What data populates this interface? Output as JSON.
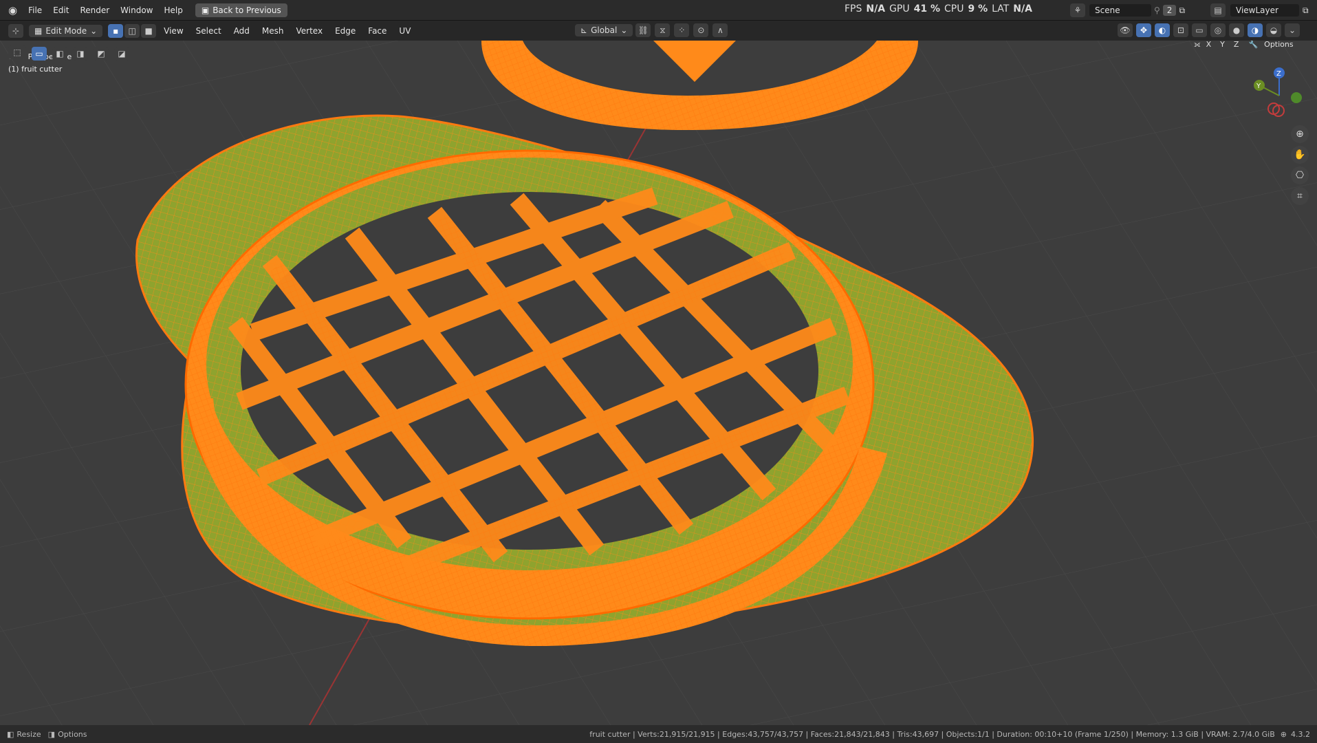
{
  "topbar": {
    "menus": [
      "File",
      "Edit",
      "Render",
      "Window",
      "Help"
    ],
    "back_button": "Back to Previous",
    "perf": {
      "fps_label": "FPS",
      "fps": "N/A",
      "gpu_label": "GPU",
      "gpu": "41 %",
      "cpu_label": "CPU",
      "cpu": "9 %",
      "lat_label": "LAT",
      "lat": "N/A"
    },
    "scene": "Scene",
    "scene_count": "2",
    "view_layer": "ViewLayer"
  },
  "header": {
    "mode": "Edit Mode",
    "menus": [
      "View",
      "Select",
      "Add",
      "Mesh",
      "Vertex",
      "Edge",
      "Face",
      "UV"
    ],
    "orientation": "Global",
    "axes": [
      "X",
      "Y",
      "Z"
    ],
    "options": "Options"
  },
  "viewport": {
    "perspective": "User Perspective",
    "object": "(1) fruit cutter",
    "colors": {
      "background": "#3d3d3d",
      "selected": "#ff8a1a",
      "face_fill": "#8fa32e",
      "x_axis": "#9a3434",
      "y_axis": "#6b8e23"
    }
  },
  "gizmo": {
    "x": "X",
    "y": "Y",
    "z": "Z"
  },
  "status": {
    "left_resize": "Resize",
    "left_options": "Options",
    "stats": "fruit cutter | Verts:21,915/21,915 | Edges:43,757/43,757 | Faces:21,843/21,843 | Tris:43,697 | Objects:1/1 | Duration: 00:10+10 (Frame 1/250) | Memory: 1.3 GiB | VRAM: 2.7/4.0 GiB",
    "version": "4.3.2"
  }
}
